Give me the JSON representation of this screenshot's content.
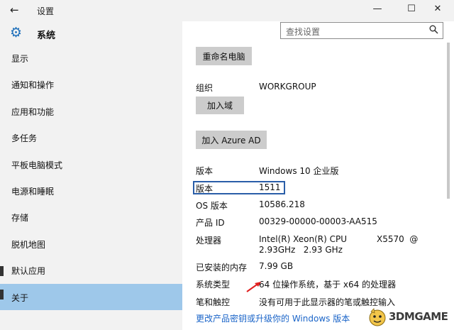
{
  "window": {
    "title": "设置",
    "back_glyph": "←",
    "minimize_glyph": "—",
    "maximize_glyph": "☐",
    "close_glyph": "✕"
  },
  "sidebar": {
    "header": "系统",
    "items": [
      {
        "label": "显示"
      },
      {
        "label": "通知和操作"
      },
      {
        "label": "应用和功能"
      },
      {
        "label": "多任务"
      },
      {
        "label": "平板电脑模式"
      },
      {
        "label": "电源和睡眠"
      },
      {
        "label": "存储"
      },
      {
        "label": "脱机地图"
      },
      {
        "label": "默认应用"
      },
      {
        "label": "关于",
        "active": true
      }
    ]
  },
  "search": {
    "placeholder": "查找设置",
    "icon": "search-icon"
  },
  "about": {
    "rename_button": "重命名电脑",
    "org_label": "组织",
    "org_value": "WORKGROUP",
    "join_domain_button": "加入域",
    "join_azure_button": "加入 Azure AD",
    "specs": [
      {
        "label": "版本",
        "value": "Windows 10 企业版"
      },
      {
        "label": "版本",
        "value": "1511"
      },
      {
        "label": "OS 版本",
        "value": "10586.218"
      },
      {
        "label": "产品 ID",
        "value": "00329-00000-00003-AA515"
      },
      {
        "label": "处理器",
        "value_line1": "Intel(R) Xeon(R) CPU           X5570  @",
        "value_line2": "2.93GHz   2.93 GHz"
      },
      {
        "label": "已安装的内存",
        "value": "7.99 GB"
      },
      {
        "label": "系统类型",
        "value": "64 位操作系统，基于 x64 的处理器"
      },
      {
        "label": "笔和触控",
        "value": "没有可用于此显示器的笔或触控输入"
      }
    ],
    "change_key_link": "更改产品密钥或升级你的 Windows 版本"
  },
  "watermark": {
    "text": "3DMGAME"
  },
  "colors": {
    "accent": "#1e6fba",
    "active_item": "#9ec8ea",
    "link": "#1a64c8",
    "highlight_border": "#2a5ea8",
    "annotation_arrow": "#e02020"
  }
}
